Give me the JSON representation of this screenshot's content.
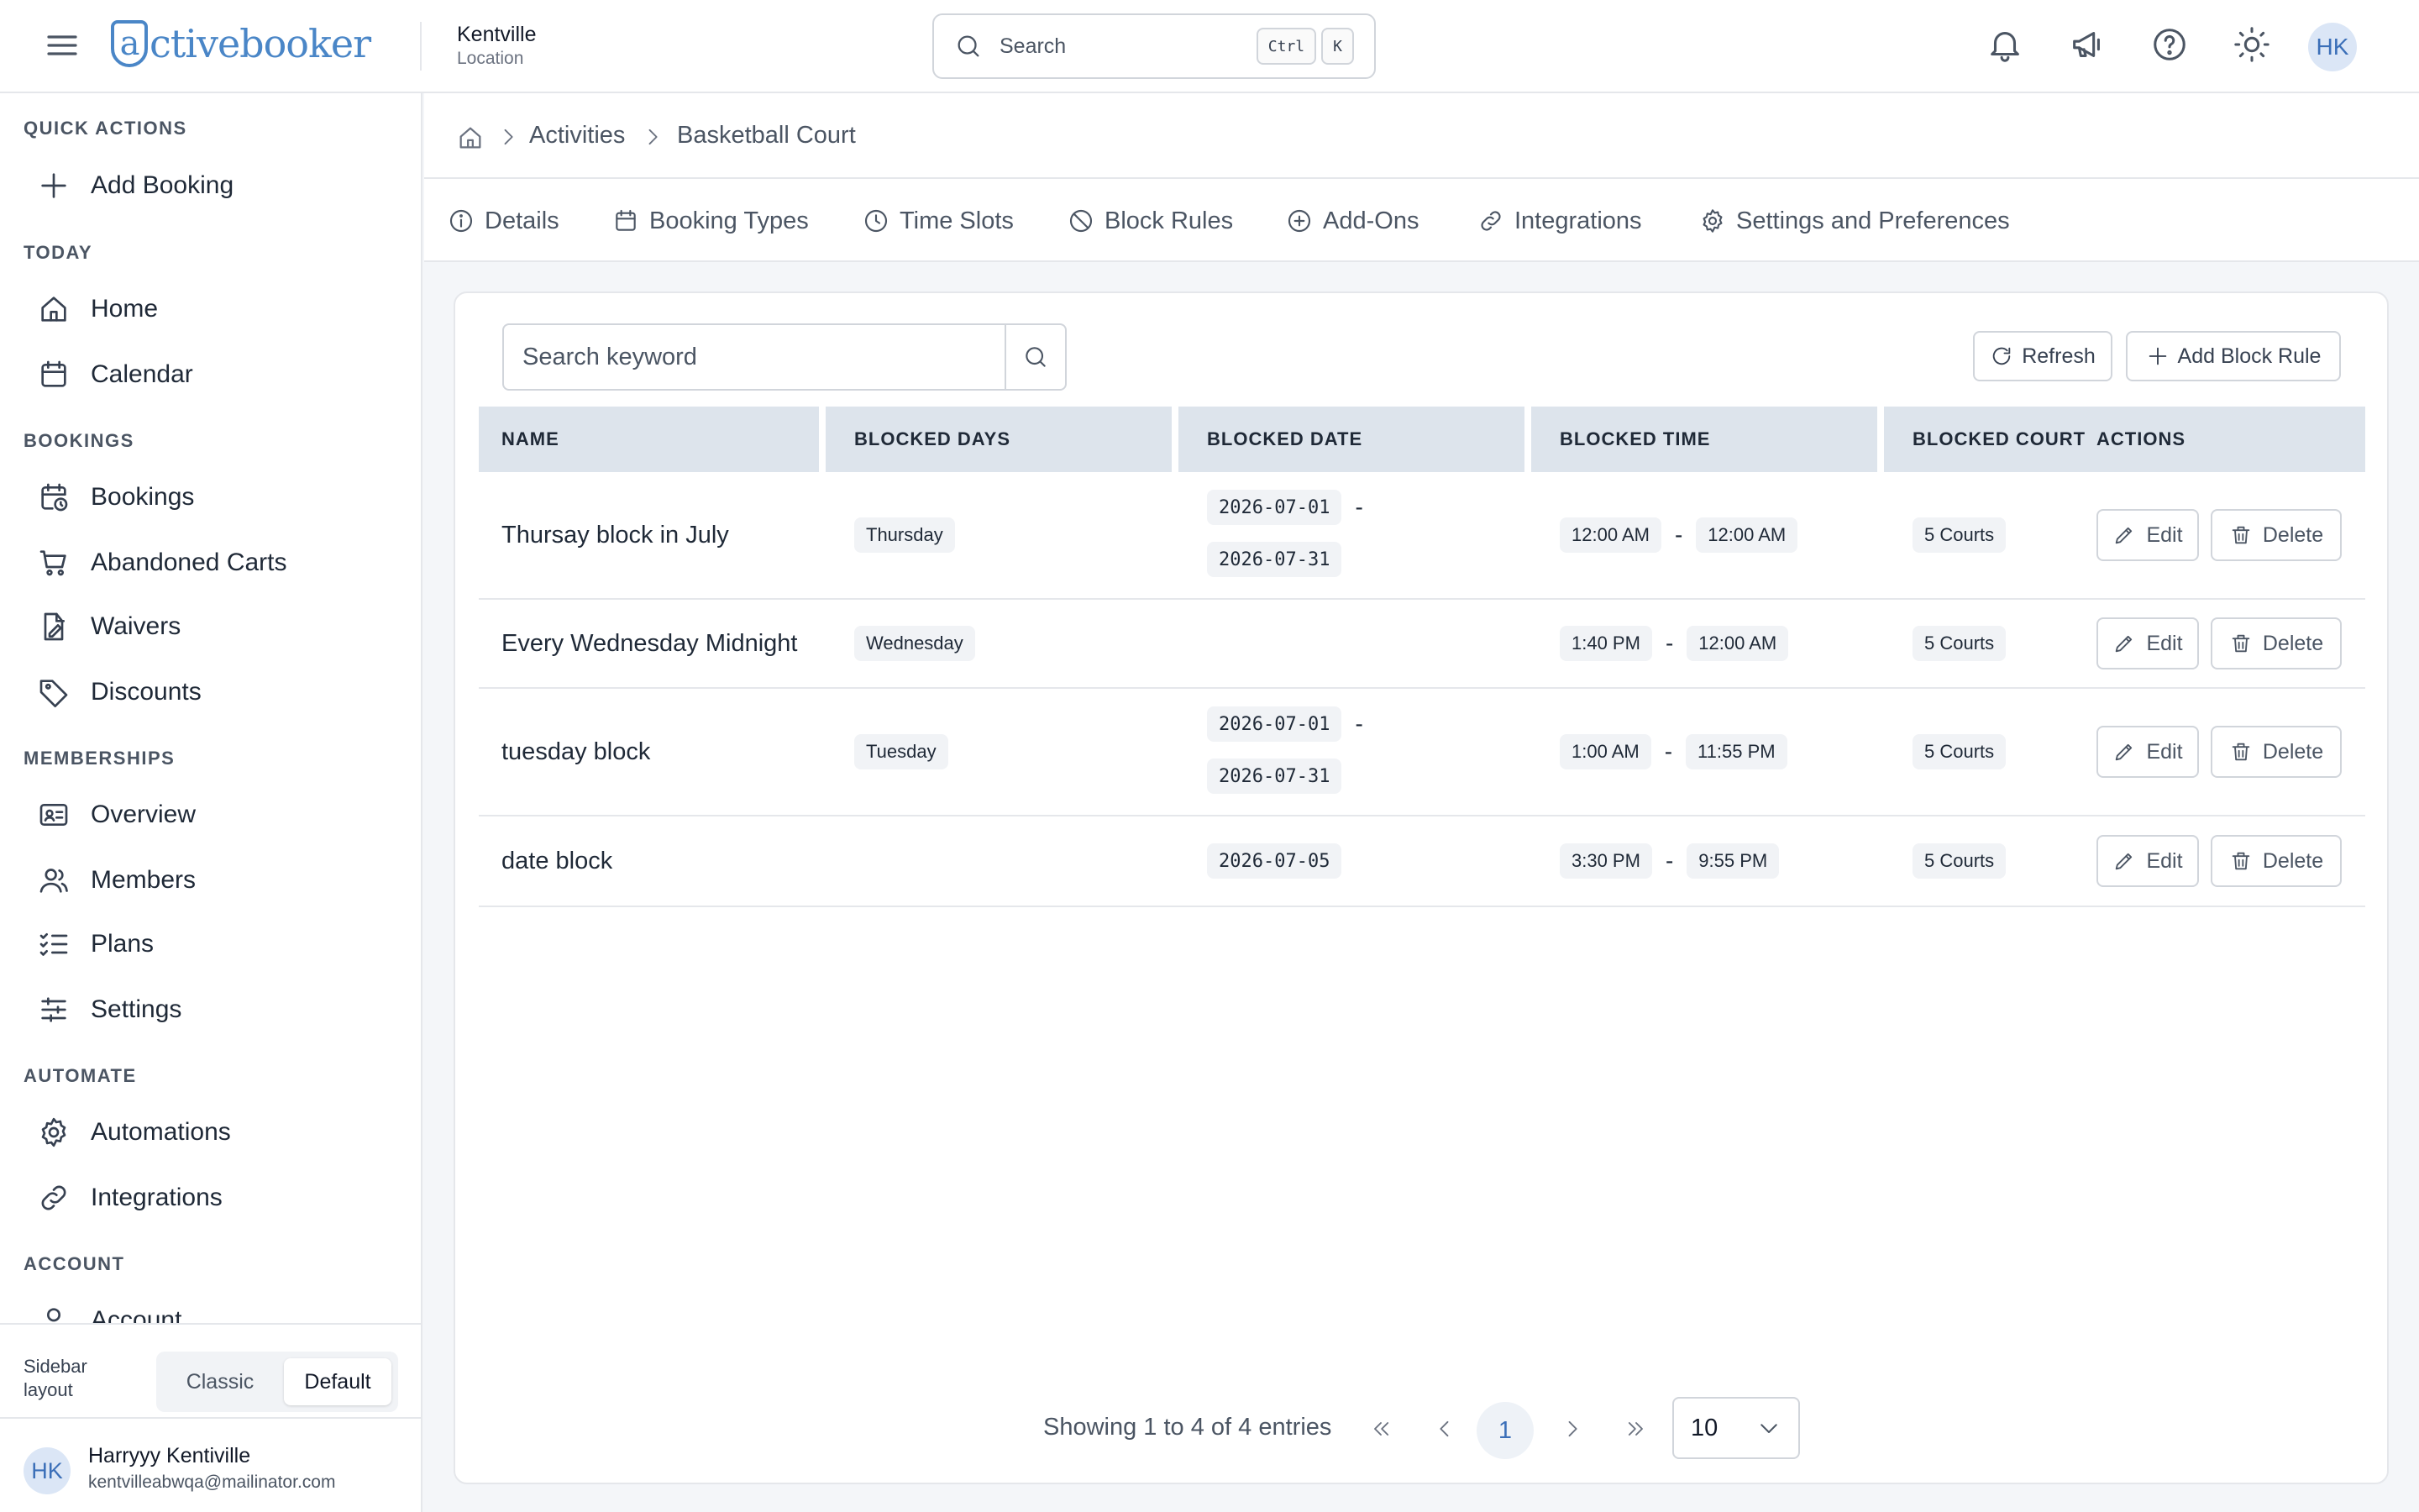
{
  "header": {
    "logo_text": "activebooker",
    "location_name": "Kentville",
    "location_label": "Location",
    "search_placeholder": "Search",
    "shortcut_keys": [
      "Ctrl",
      "K"
    ],
    "avatar_initials": "HK",
    "icons": [
      "menu-icon",
      "bell-icon",
      "megaphone-icon",
      "help-icon",
      "sun-icon"
    ]
  },
  "sidebar": {
    "sections": [
      {
        "title": "QUICK ACTIONS",
        "items": [
          {
            "label": "Add Booking",
            "icon": "plus-icon"
          }
        ]
      },
      {
        "title": "TODAY",
        "items": [
          {
            "label": "Home",
            "icon": "home-icon"
          },
          {
            "label": "Calendar",
            "icon": "calendar-icon"
          }
        ]
      },
      {
        "title": "BOOKINGS",
        "items": [
          {
            "label": "Bookings",
            "icon": "calendar-clock-icon"
          },
          {
            "label": "Abandoned Carts",
            "icon": "cart-icon"
          },
          {
            "label": "Waivers",
            "icon": "file-signature-icon"
          },
          {
            "label": "Discounts",
            "icon": "tag-icon"
          }
        ]
      },
      {
        "title": "MEMBERSHIPS",
        "items": [
          {
            "label": "Overview",
            "icon": "id-card-icon"
          },
          {
            "label": "Members",
            "icon": "users-icon"
          },
          {
            "label": "Plans",
            "icon": "list-checks-icon"
          },
          {
            "label": "Settings",
            "icon": "sliders-icon"
          }
        ]
      },
      {
        "title": "AUTOMATE",
        "items": [
          {
            "label": "Automations",
            "icon": "gear-icon"
          },
          {
            "label": "Integrations",
            "icon": "link-icon"
          }
        ]
      },
      {
        "title": "ACCOUNT",
        "items": [
          {
            "label": "Account",
            "icon": "user-icon"
          }
        ]
      }
    ],
    "layout_label": "Sidebar layout",
    "layout_options": [
      "Classic",
      "Default"
    ],
    "layout_selected": "Default",
    "user": {
      "initials": "HK",
      "name": "Harryyy Kentiville",
      "email": "kentvilleabwqa@mailinator.com"
    }
  },
  "breadcrumb": {
    "items": [
      "Activities",
      "Basketball Court"
    ]
  },
  "tabs": [
    {
      "label": "Details",
      "icon": "info-icon"
    },
    {
      "label": "Booking Types",
      "icon": "calendar-icon"
    },
    {
      "label": "Time Slots",
      "icon": "clock-icon"
    },
    {
      "label": "Block Rules",
      "icon": "ban-icon"
    },
    {
      "label": "Add-Ons",
      "icon": "plus-circle-icon"
    },
    {
      "label": "Integrations",
      "icon": "link-icon"
    },
    {
      "label": "Settings and Preferences",
      "icon": "gear-icon"
    }
  ],
  "toolbar": {
    "search_placeholder": "Search keyword",
    "refresh_label": "Refresh",
    "add_label": "Add Block Rule"
  },
  "table": {
    "headers": [
      "NAME",
      "BLOCKED DAYS",
      "BLOCKED DATE",
      "BLOCKED TIME",
      "BLOCKED COURT",
      "ACTIONS"
    ],
    "rows": [
      {
        "name": "Thursay block in July",
        "days": "Thursday",
        "date_from": "2026-07-01",
        "date_to": "2026-07-31",
        "time_from": "12:00 AM",
        "time_to": "12:00 AM",
        "court": "5 Courts"
      },
      {
        "name": "Every Wednesday Midnight",
        "days": "Wednesday",
        "date_from": "",
        "date_to": "",
        "time_from": "1:40 PM",
        "time_to": "12:00 AM",
        "court": "5 Courts"
      },
      {
        "name": "tuesday block",
        "days": "Tuesday",
        "date_from": "2026-07-01",
        "date_to": "2026-07-31",
        "time_from": "1:00 AM",
        "time_to": "11:55 PM",
        "court": "5 Courts"
      },
      {
        "name": "date block",
        "days": "",
        "date_from": "2026-07-05",
        "date_to": "",
        "time_from": "3:30 PM",
        "time_to": "9:55 PM",
        "court": "5 Courts"
      }
    ],
    "separator": "-",
    "edit_label": "Edit",
    "delete_label": "Delete"
  },
  "pagination": {
    "info": "Showing 1 to 4 of 4 entries",
    "current_page": "1",
    "page_size": "10"
  },
  "colors": {
    "brand": "#4a86c7",
    "header_bg": "#dde4ec",
    "page_bg": "#f4f6f9"
  }
}
